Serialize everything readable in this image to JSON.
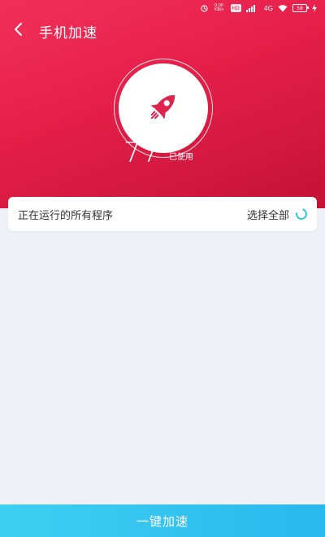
{
  "status_bar": {
    "speed_value": "0.00",
    "speed_unit": "KB/s",
    "hd": "HD",
    "network": "4G",
    "battery": "58"
  },
  "header": {
    "title": "手机加速"
  },
  "gauge": {
    "value": "77",
    "unit": "%",
    "label": "已使用"
  },
  "program_list": {
    "title": "正在运行的所有程序",
    "select_all": "选择全部"
  },
  "action": {
    "boost_label": "一键加速"
  },
  "colors": {
    "hero": "#e6204a",
    "accent": "#2ec9d9",
    "button": "#34c4ef"
  }
}
